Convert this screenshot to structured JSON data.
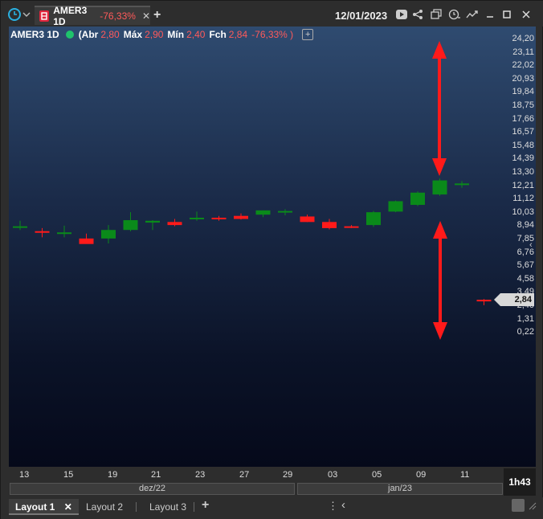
{
  "tab": {
    "ticker_label": "AMER3 1D",
    "change": "-76,33%",
    "close_label": "✕",
    "add_label": "+"
  },
  "header": {
    "date": "12/01/2023"
  },
  "legend": {
    "symbol": "AMER3 1D",
    "open_prefix": "(Abr",
    "open": "2,80",
    "high_label": "Máx",
    "high": "2,90",
    "low_label": "Mín",
    "low": "2,40",
    "close_label": "Fch",
    "close": "2,84",
    "change": "-76,33% )",
    "add": "+"
  },
  "price_axis": [
    "24,20",
    "23,11",
    "22,02",
    "20,93",
    "19,84",
    "18,75",
    "17,66",
    "16,57",
    "15,48",
    "14,39",
    "13,30",
    "12,21",
    "11,12",
    "10,03",
    "8,94",
    "7,85",
    "6,76",
    "5,67",
    "4,58",
    "3,49",
    "2,40",
    "1,31",
    "0,22"
  ],
  "current_price": "2,84",
  "date_axis": [
    "13",
    "15",
    "19",
    "21",
    "23",
    "27",
    "29",
    "03",
    "05",
    "09",
    "11"
  ],
  "months": [
    "dez/22",
    "jan/23"
  ],
  "timer": "1h43",
  "footer": {
    "layouts": [
      "Layout 1",
      "Layout 2",
      "Layout 3"
    ],
    "close": "✕",
    "add": "+",
    "more": "⋮",
    "back": "‹"
  },
  "colors": {
    "up": "#0a8a1a",
    "down": "#ff1a1a",
    "annotation": "#ff1a1a",
    "positive_dot": "#1fc36c"
  },
  "chart_data": {
    "type": "candlestick",
    "title": "AMER3 1D",
    "x": [
      "13",
      "14",
      "15",
      "16",
      "19",
      "20",
      "21",
      "22",
      "23",
      "26",
      "27",
      "28",
      "29",
      "02",
      "03",
      "04",
      "05",
      "06",
      "09",
      "10",
      "11",
      "12"
    ],
    "open": [
      8.85,
      8.45,
      8.35,
      7.85,
      7.85,
      8.55,
      9.15,
      9.2,
      9.55,
      9.55,
      9.7,
      9.8,
      10.1,
      9.65,
      9.2,
      8.85,
      8.95,
      10.05,
      10.6,
      11.45,
      12.35,
      2.84
    ],
    "high": [
      9.3,
      8.7,
      8.9,
      8.25,
      8.95,
      10.0,
      9.35,
      9.45,
      10.05,
      9.7,
      9.9,
      10.15,
      10.25,
      9.8,
      9.45,
      8.95,
      10.1,
      10.95,
      11.7,
      12.75,
      12.55,
      2.9
    ],
    "low": [
      8.55,
      7.95,
      7.95,
      7.45,
      7.45,
      8.45,
      8.55,
      8.85,
      9.3,
      9.3,
      9.4,
      9.6,
      9.75,
      9.2,
      8.6,
      8.7,
      8.8,
      10.0,
      10.5,
      11.35,
      12.0,
      2.4
    ],
    "close": [
      8.85,
      8.45,
      8.35,
      7.4,
      8.55,
      9.35,
      9.3,
      8.95,
      9.5,
      9.55,
      9.45,
      10.15,
      10.1,
      9.2,
      8.7,
      8.85,
      10.0,
      10.9,
      11.6,
      12.6,
      12.35,
      2.84
    ],
    "ylim": [
      0.22,
      24.2
    ]
  }
}
